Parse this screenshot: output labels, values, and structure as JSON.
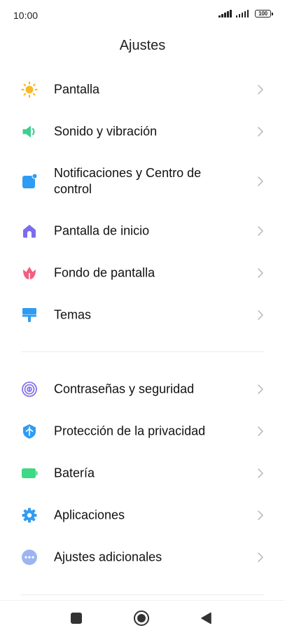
{
  "status_bar": {
    "time": "10:00",
    "battery": "100"
  },
  "header": {
    "title": "Ajustes"
  },
  "sections": [
    {
      "items": [
        {
          "label": "Pantalla",
          "icon": "sun-icon",
          "color": "#f9b82a"
        },
        {
          "label": "Sonido y vibración",
          "icon": "speaker-icon",
          "color": "#3ecf8e"
        },
        {
          "label": "Notificaciones y Centro de control",
          "icon": "notification-icon",
          "color": "#2f9cf4"
        },
        {
          "label": "Pantalla de inicio",
          "icon": "home-icon",
          "color": "#7b6cf0"
        },
        {
          "label": "Fondo de pantalla",
          "icon": "tulip-icon",
          "color": "#f25f80"
        },
        {
          "label": "Temas",
          "icon": "paint-roller-icon",
          "color": "#2f9cf4"
        }
      ]
    },
    {
      "items": [
        {
          "label": "Contraseñas y seguridad",
          "icon": "fingerprint-icon",
          "color": "#8a74e8"
        },
        {
          "label": "Protección de la privacidad",
          "icon": "shield-icon",
          "color": "#2f9cf4"
        },
        {
          "label": "Batería",
          "icon": "battery-icon",
          "color": "#3fd884"
        },
        {
          "label": "Aplicaciones",
          "icon": "gear-icon",
          "color": "#2f9cf4"
        },
        {
          "label": "Ajustes adicionales",
          "icon": "more-dots-icon",
          "color": "#9cb5f0"
        }
      ]
    }
  ],
  "nav_bar": {
    "buttons": [
      "recents-square-icon",
      "home-circle-icon",
      "back-triangle-icon"
    ]
  }
}
